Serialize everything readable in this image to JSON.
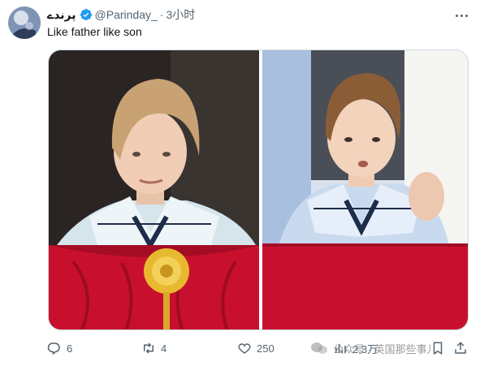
{
  "author": {
    "display_name": "پرندے",
    "handle": "@Parinday_",
    "separator": "·",
    "time": "3小时",
    "avatar_icon": "avatar-photo"
  },
  "tweet": {
    "text": "Like father like son"
  },
  "media": {
    "photos": [
      {
        "subject": "boy-blond-sailor-suit-balcony"
      },
      {
        "subject": "boy-brown-hair-sailor-suit-balcony"
      }
    ]
  },
  "actions": {
    "reply_count": "6",
    "retweet_count": "4",
    "like_count": "250",
    "views_count": "2.3万"
  },
  "watermark": {
    "text": "公众号 · 英国那些事儿"
  },
  "colors": {
    "verified": "#1d9bf0",
    "secondary_text": "#536471",
    "balcony_red": "#c8102e"
  }
}
